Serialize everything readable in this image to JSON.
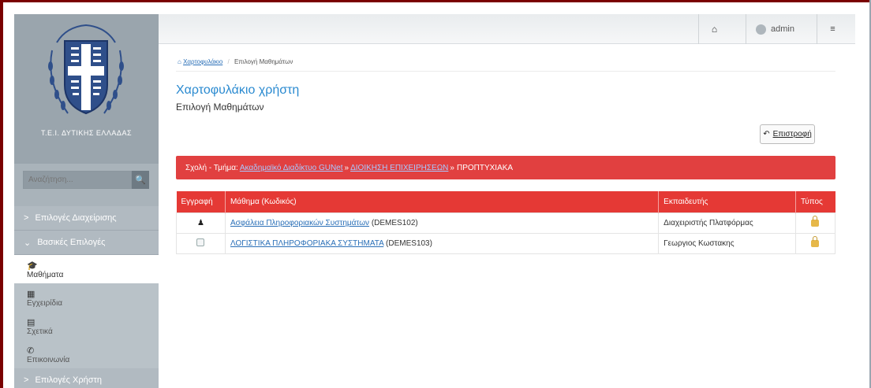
{
  "sidebar": {
    "institution": "Τ.Ε.Ι. ΔΥΤΙΚΗΣ ΕΛΛΑΔΑΣ",
    "search_placeholder": "Αναζήτηση...",
    "nav": [
      {
        "label": "Επιλογές Διαχείρισης"
      },
      {
        "label": "Βασικές Επιλογές"
      }
    ],
    "sub_items": [
      {
        "label": "Μαθήματα",
        "icon": "graduation-cap-icon"
      },
      {
        "label": "Εγχειρίδια",
        "icon": "document-icon"
      },
      {
        "label": "Σχετικά",
        "icon": "card-icon"
      },
      {
        "label": "Επικοινωνία",
        "icon": "phone-icon"
      }
    ],
    "nav_bottom": {
      "label": "Επιλογές Χρήστη"
    }
  },
  "topbar": {
    "user": "admin"
  },
  "breadcrumb": {
    "home": "Χαρτοφυλάκιο",
    "separator": "/",
    "current": "Επιλογή Μαθημάτων"
  },
  "page": {
    "title": "Χαρτοφυλάκιο χρήστη",
    "subtitle": "Επιλογή Μαθημάτων",
    "back_label": "Επιστροφή"
  },
  "alert": {
    "prefix": "Σχολή - Τμήμα:",
    "link1": "Ακαδημαϊκό Διαδίκτυο GUNet",
    "sep1": "»",
    "link2": "ΔΙΟΙΚΗΣΗ ΕΠΙΧΕΙΡΗΣΕΩΝ",
    "sep2": "»",
    "suffix": "ΠΡΟΠΤΥΧΙΑΚΑ"
  },
  "table": {
    "headers": [
      "Εγγραφή",
      "Μάθημα (Κωδικός)",
      "Εκπαιδευτής",
      "Τύπος"
    ],
    "rows": [
      {
        "course": "Ασφάλεια Πληροφοριακών Συστημάτων",
        "code": "(DEMES102)",
        "instructor": "Διαχειριστής Πλατφόρμας",
        "registered": true
      },
      {
        "course": "ΛΟΓΙΣΤΙΚΑ ΠΛΗΡΟΦΟΡΙΑΚΑ ΣΥΣΤΗΜΑΤΑ",
        "code": "(DEMES103)",
        "instructor": "Γεωργιος Κωστακης",
        "registered": false
      }
    ]
  },
  "colors": {
    "accent_red": "#e53935",
    "link_blue": "#2a6fb7",
    "title_blue": "#2a8ad0"
  }
}
